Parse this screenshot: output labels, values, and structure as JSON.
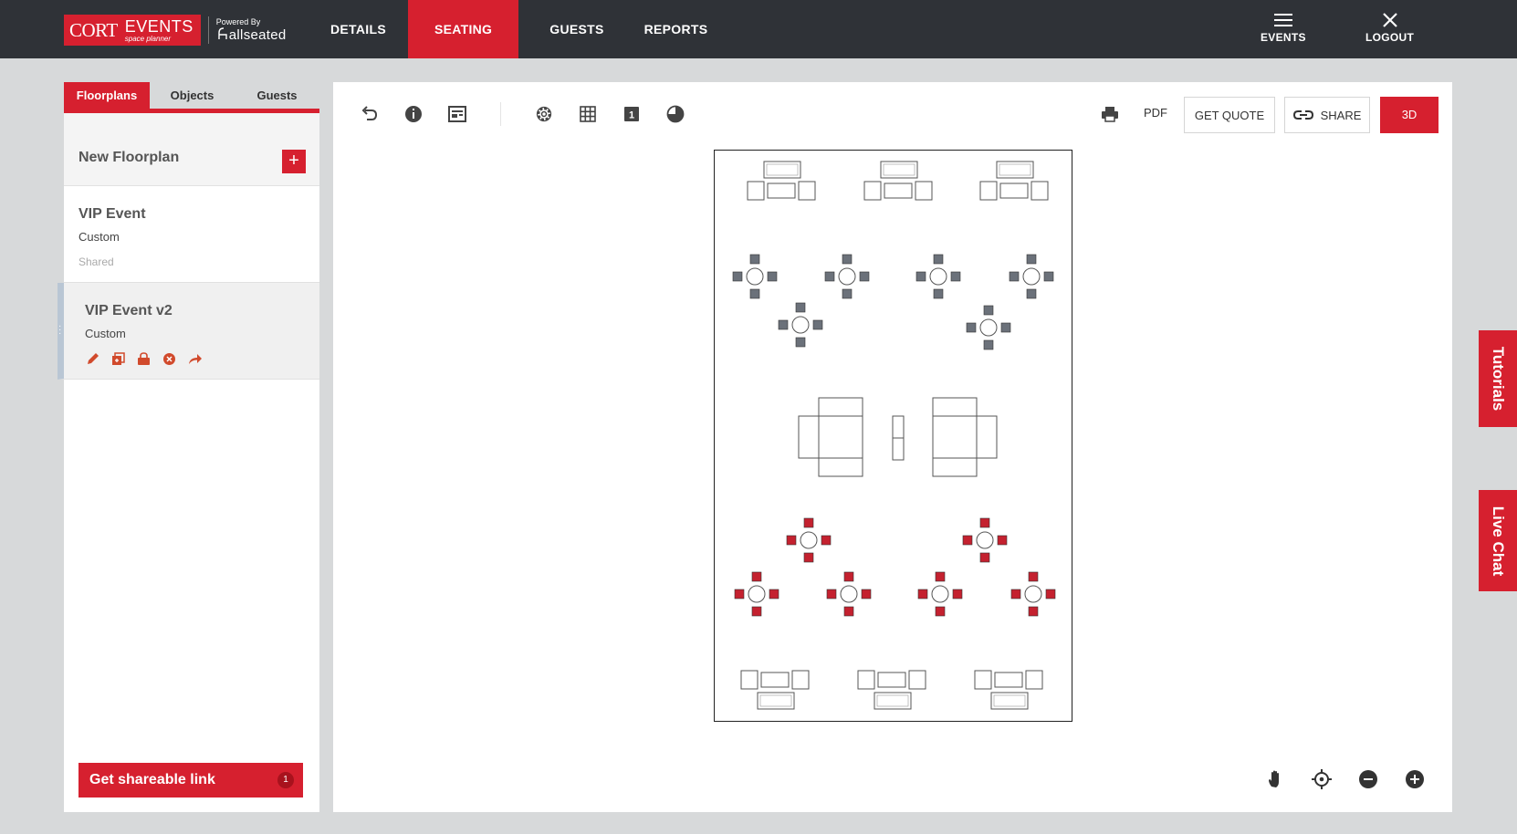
{
  "logo": {
    "cort": "CORT",
    "events": "EVENTS",
    "events_sub": "space planner",
    "powered_by": "Powered By",
    "partner": "allseated"
  },
  "nav": [
    {
      "label": "DETAILS"
    },
    {
      "label": "SEATING"
    },
    {
      "label": "GUESTS"
    },
    {
      "label": "REPORTS"
    }
  ],
  "topbar_right": {
    "events_label": "EVENTS",
    "logout_label": "LOGOUT"
  },
  "panel": {
    "tabs": [
      {
        "label": "Floorplans"
      },
      {
        "label": "Objects"
      },
      {
        "label": "Guests"
      }
    ],
    "new_floorplan": "New Floorplan",
    "add_symbol": "+",
    "floorplans": [
      {
        "title": "VIP Event",
        "type": "Custom",
        "status": "Shared"
      },
      {
        "title": "VIP Event v2",
        "type": "Custom"
      }
    ],
    "share_button": "Get shareable link",
    "share_count": "1"
  },
  "toolbar": {
    "layer_number": "1",
    "pdf": "PDF",
    "get_quote": "GET QUOTE",
    "share": "SHARE",
    "three_d": "3D"
  },
  "side_tabs": {
    "tutorials": "Tutorials",
    "live_chat": "Live Chat"
  },
  "colors": {
    "brand_red": "#d6202f",
    "topbar": "#2f3237",
    "chair_gray": "#6b717a",
    "chair_red": "#c4212f"
  }
}
